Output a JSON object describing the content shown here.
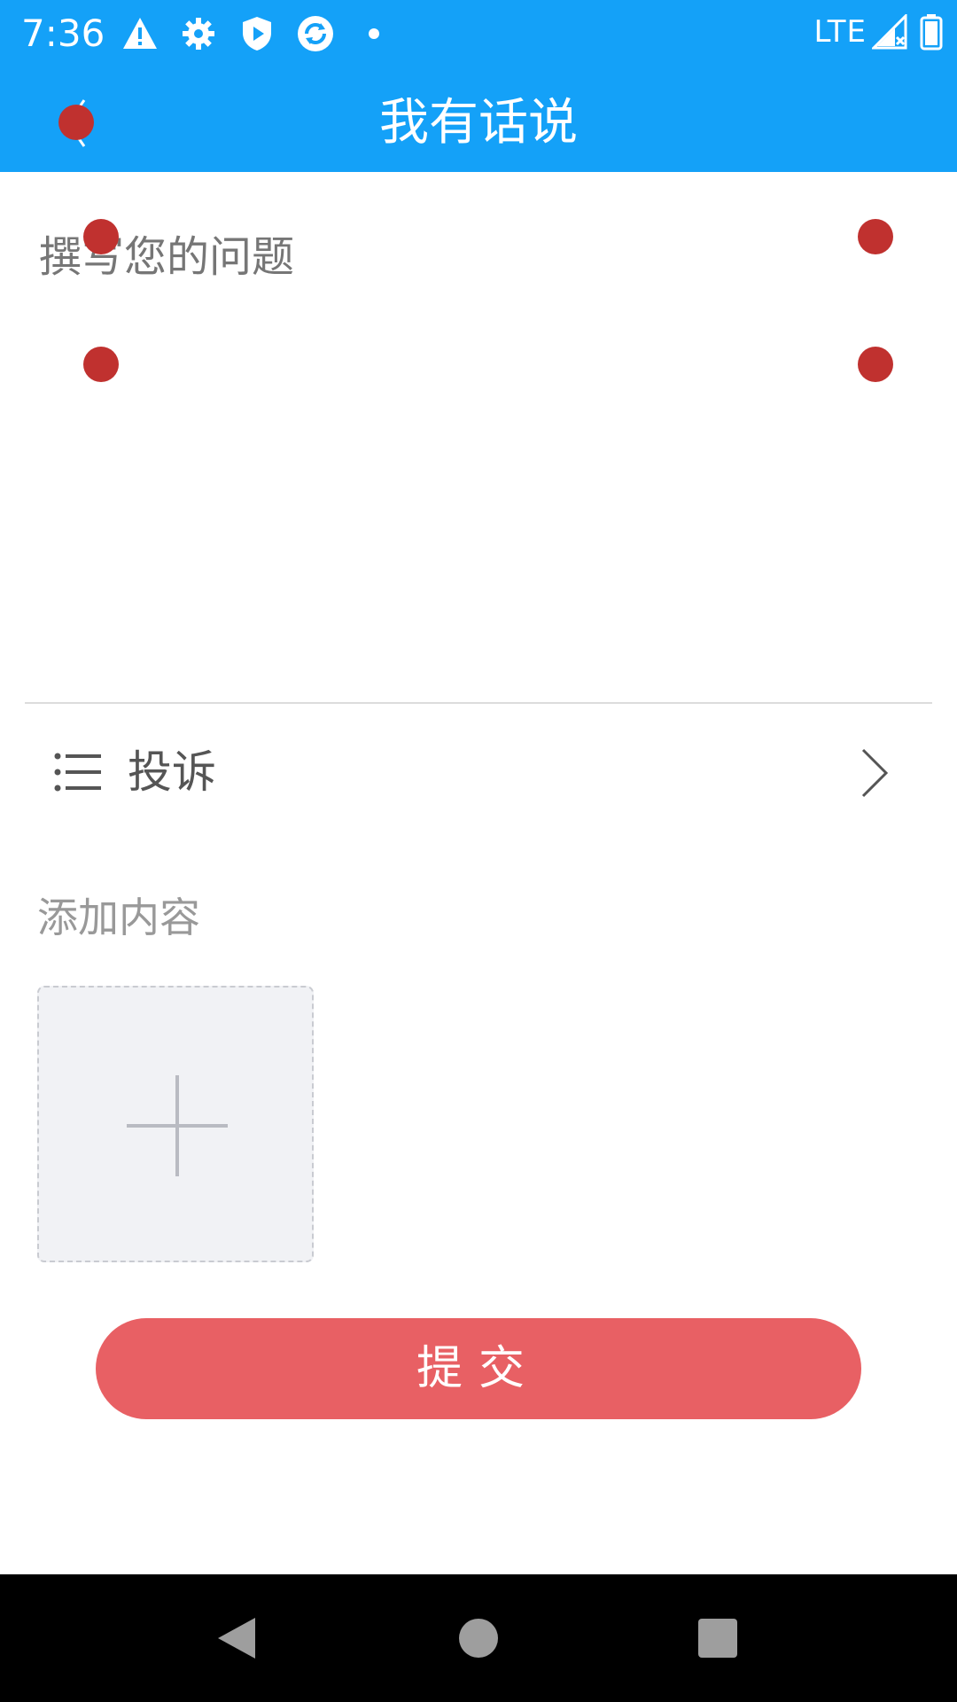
{
  "status_bar": {
    "time": "7:36",
    "network": "LTE",
    "icons": [
      "warning-icon",
      "gear-icon",
      "shield-play-icon",
      "sync-icon",
      "dot-icon",
      "signal-icon",
      "battery-icon"
    ]
  },
  "app_bar": {
    "title": "我有话说",
    "back_icon": "chevron-left-icon"
  },
  "question": {
    "value": "",
    "placeholder": "撰写您的问题"
  },
  "category": {
    "label": "投诉",
    "icon": "list-icon",
    "chevron_icon": "chevron-right-icon"
  },
  "attachments": {
    "label": "添加内容",
    "add_icon": "plus-icon"
  },
  "submit": {
    "label": "提交"
  },
  "nav_bar": {
    "icons": [
      "back-triangle-icon",
      "home-circle-icon",
      "recents-square-icon"
    ]
  },
  "colors": {
    "header": "#14A1F8",
    "submit_button": "#E86064",
    "marker": "#C0312F",
    "divider": "#DCDCDC"
  }
}
